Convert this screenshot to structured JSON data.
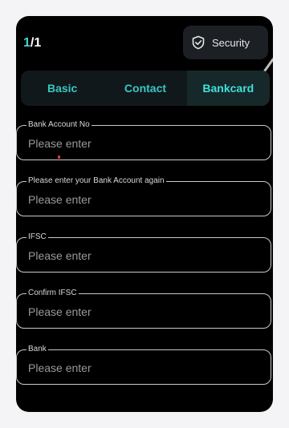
{
  "header": {
    "counter_current": "1",
    "counter_total": "/1",
    "security_label": "Security"
  },
  "tabs": [
    {
      "label": "Basic",
      "active": false
    },
    {
      "label": "Contact",
      "active": false
    },
    {
      "label": "Bankcard",
      "active": true
    }
  ],
  "form": {
    "fields": [
      {
        "label": "Bank Account No",
        "placeholder": "Please enter",
        "value": ""
      },
      {
        "label": "Please enter your Bank Account again",
        "placeholder": "Please enter",
        "value": ""
      },
      {
        "label": "IFSC",
        "placeholder": "Please enter",
        "value": ""
      },
      {
        "label": "Confirm IFSC",
        "placeholder": "Please enter",
        "value": ""
      },
      {
        "label": "Bank",
        "placeholder": "Please enter",
        "value": ""
      }
    ]
  },
  "icons": {
    "security": "shield-check-icon"
  },
  "colors": {
    "accent": "#3fe0d8",
    "background": "#000000",
    "panel": "#1c2024"
  }
}
